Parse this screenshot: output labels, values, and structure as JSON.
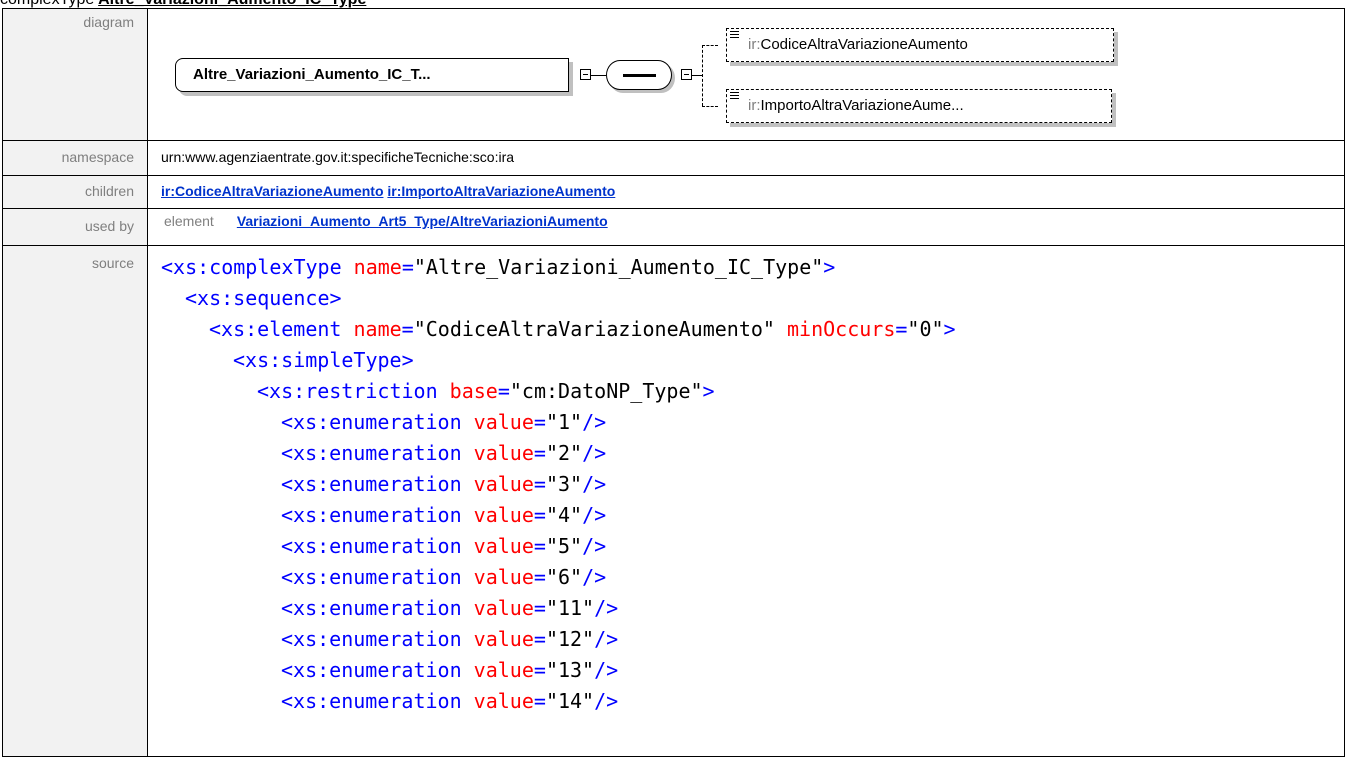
{
  "header": {
    "prefix": "complexType",
    "name": "Altre_Variazioni_Aumento_IC_Type"
  },
  "rows": {
    "diagram_label": "diagram",
    "namespace_label": "namespace",
    "children_label": "children",
    "usedby_label": "used by",
    "source_label": "source"
  },
  "diagram": {
    "root": "Altre_Variazioni_Aumento_IC_T...",
    "children": [
      {
        "prefix": "ir:",
        "name": "CodiceAltraVariazioneAumento"
      },
      {
        "prefix": "ir:",
        "name": "ImportoAltraVariazioneAume..."
      }
    ]
  },
  "namespace": "urn:www.agenziaentrate.gov.it:specificheTecniche:sco:ira",
  "children_links": [
    "ir:CodiceAltraVariazioneAumento",
    "ir:ImportoAltraVariazioneAumento"
  ],
  "used_by": {
    "kind": "element",
    "link": "Variazioni_Aumento_Art5_Type/AltreVariazioniAumento"
  },
  "source": {
    "ct_open": "<xs:complexType",
    "ct_name": "\"Altre_Variazioni_Aumento_IC_Type\"",
    "seq": "<xs:sequence>",
    "el_open": "<xs:element",
    "el_name": "\"CodiceAltraVariazioneAumento\"",
    "el_min": "\"0\"",
    "st": "<xs:simpleType>",
    "rs_open": "<xs:restriction",
    "rs_base": "\"cm:DatoNP_Type\"",
    "enum_tag": "<xs:enumeration",
    "name_attr": "name",
    "min_attr": "minOccurs",
    "base_attr": "base",
    "value_attr": "value",
    "enum_values": [
      "\"1\"",
      "\"2\"",
      "\"3\"",
      "\"4\"",
      "\"5\"",
      "\"6\"",
      "\"11\"",
      "\"12\"",
      "\"13\"",
      "\"14\""
    ]
  }
}
